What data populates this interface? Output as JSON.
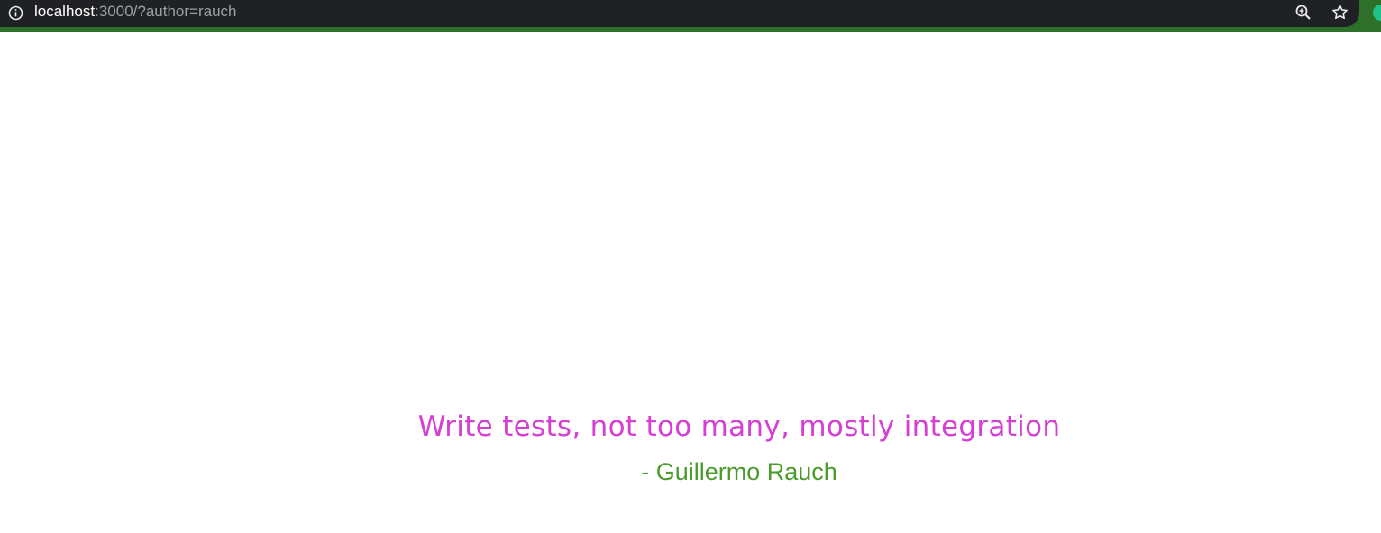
{
  "browser": {
    "url_host": "localhost",
    "url_rest": ":3000/?author=rauch",
    "icons": [
      "info-icon",
      "zoom-icon",
      "star-icon",
      "extension-icon"
    ],
    "colors": {
      "omnibox": "#202124",
      "frame": "#2e6f2a"
    }
  },
  "quote": {
    "text": "Write tests, not too many, mostly integration",
    "author": "- Guillermo Rauch",
    "colors": {
      "text": "#d63fd3",
      "author": "#4b9b2d"
    }
  }
}
